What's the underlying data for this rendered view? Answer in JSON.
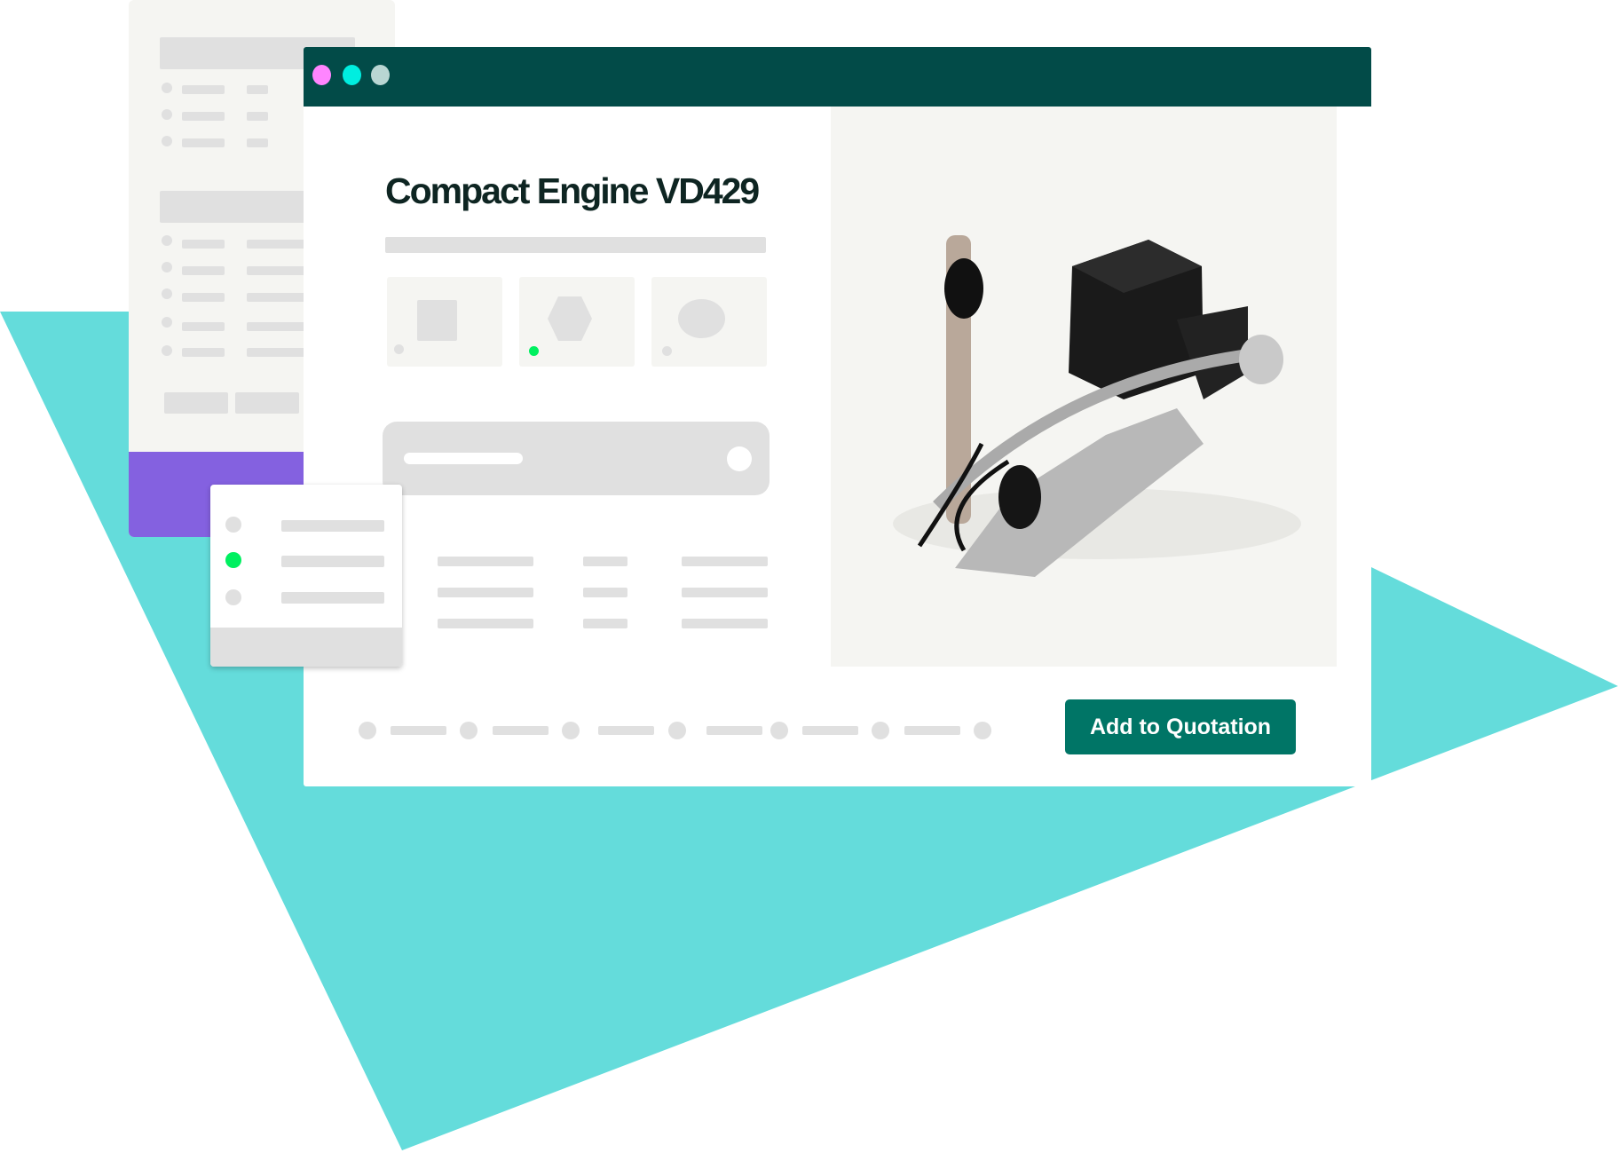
{
  "product": {
    "title": "Compact Engine VD429"
  },
  "actions": {
    "add_to_quotation": "Add to Quotation"
  },
  "window": {
    "controls": [
      {
        "name": "close",
        "color": "#ff85ff"
      },
      {
        "name": "minimize",
        "color": "#00eee0"
      },
      {
        "name": "maximize",
        "color": "#b9d6d3"
      }
    ],
    "titlebar_color": "#024b48"
  },
  "colors": {
    "accent": "#007566",
    "teal_background": "#64dcdb",
    "purple": "#8461e0",
    "selected_dot": "#00f060"
  },
  "thumbnails": [
    {
      "shape": "square",
      "selected": false
    },
    {
      "shape": "hexagon",
      "selected": true
    },
    {
      "shape": "ellipse",
      "selected": false
    }
  ],
  "stepper": {
    "steps": 7
  },
  "popup_list": {
    "selected_index": 1,
    "items": 3
  }
}
